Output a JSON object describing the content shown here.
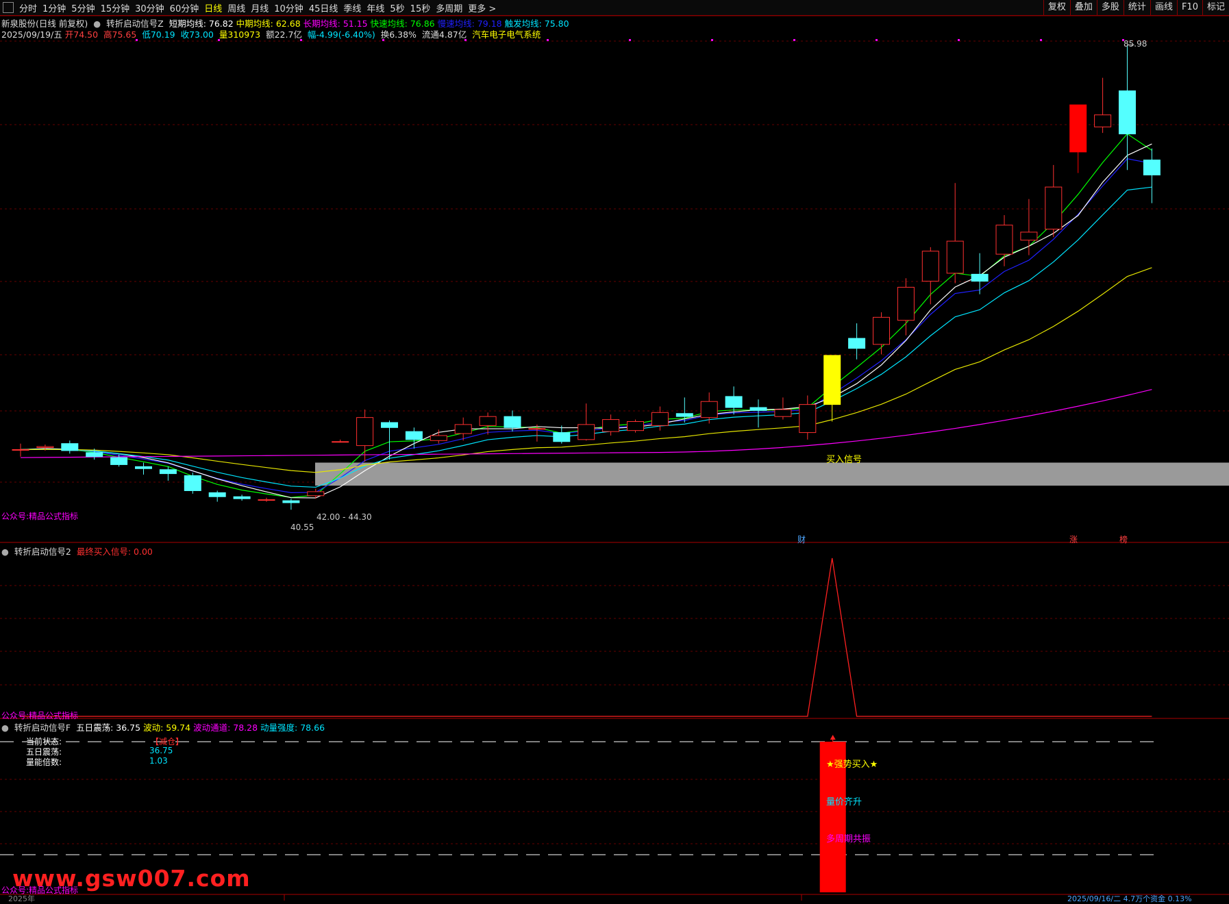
{
  "toolbar": {
    "periods": [
      "分时",
      "1分钟",
      "5分钟",
      "15分钟",
      "30分钟",
      "60分钟",
      "日线",
      "周线",
      "月线",
      "10分钟",
      "45日线",
      "季线",
      "年线",
      "5秒",
      "15秒",
      "多周期",
      "更多 >"
    ],
    "active_period": "日线",
    "right_buttons": [
      "复权",
      "叠加",
      "多股",
      "统计",
      "画线",
      "F10",
      "标记"
    ]
  },
  "header": {
    "stock_title": "新泉股份(日线 前复权)",
    "indicator_name": "转折启动信号Z",
    "ma": [
      {
        "label": "短期均线:",
        "value": "76.82",
        "color": "#ffffff"
      },
      {
        "label": "中期均线:",
        "value": "62.68",
        "color": "#ffff00"
      },
      {
        "label": "长期均线:",
        "value": "51.15",
        "color": "#ff00ff"
      },
      {
        "label": "快速均线:",
        "value": "76.86",
        "color": "#00ff00"
      },
      {
        "label": "慢速均线:",
        "value": "79.18",
        "color": "#2020ff"
      },
      {
        "label": "触发均线:",
        "value": "75.80",
        "color": "#00e5ff"
      }
    ]
  },
  "quote": {
    "date": "2025/09/19/五",
    "open": "开74.50",
    "high": "高75.65",
    "low": "低70.19",
    "close": "收73.00",
    "volume": "量310973",
    "amount": "额22.7亿",
    "change": "幅-4.99(-6.40%)",
    "turnover": "换6.38%",
    "float": "流通4.87亿",
    "sector": "汽车电子电气系统"
  },
  "main_chart": {
    "price_high_label": "85.98",
    "price_low_label": "40.55",
    "range_label": "42.00 - 44.30",
    "buy_signal_label": "买入信号",
    "footer_label": "公众号:精品公式指标",
    "markers": [
      {
        "text": "财",
        "color": "#4da6ff"
      },
      {
        "text": "涨",
        "color": "#ff4040"
      },
      {
        "text": "榜",
        "color": "#ff4040"
      }
    ],
    "candles": [
      {
        "o": 45.6,
        "c": 45.6,
        "h": 46.2,
        "l": 44.9,
        "dir": "up"
      },
      {
        "o": 45.9,
        "c": 45.8,
        "h": 46.1,
        "l": 45.5,
        "dir": "up"
      },
      {
        "o": 46.2,
        "c": 45.5,
        "h": 46.5,
        "l": 45.2,
        "dir": "down"
      },
      {
        "o": 45.3,
        "c": 44.9,
        "h": 45.7,
        "l": 44.6,
        "dir": "down"
      },
      {
        "o": 44.8,
        "c": 44.1,
        "h": 45.1,
        "l": 43.9,
        "dir": "down"
      },
      {
        "o": 43.9,
        "c": 43.7,
        "h": 44.3,
        "l": 43.1,
        "dir": "down"
      },
      {
        "o": 43.6,
        "c": 43.2,
        "h": 43.9,
        "l": 42.5,
        "dir": "down"
      },
      {
        "o": 43.0,
        "c": 41.5,
        "h": 43.3,
        "l": 41.2,
        "dir": "down"
      },
      {
        "o": 41.3,
        "c": 40.9,
        "h": 41.5,
        "l": 40.4,
        "dir": "down"
      },
      {
        "o": 40.9,
        "c": 40.7,
        "h": 41.1,
        "l": 40.5,
        "dir": "down"
      },
      {
        "o": 40.6,
        "c": 40.6,
        "h": 40.8,
        "l": 40.4,
        "dir": "up"
      },
      {
        "o": 40.5,
        "c": 40.3,
        "h": 40.7,
        "l": 39.6,
        "dir": "down"
      },
      {
        "o": 41.0,
        "c": 41.4,
        "h": 41.7,
        "l": 40.7,
        "dir": "up"
      },
      {
        "o": 46.4,
        "c": 46.4,
        "h": 46.6,
        "l": 46.3,
        "dir": "up"
      },
      {
        "o": 46.0,
        "c": 48.8,
        "h": 49.6,
        "l": 44.4,
        "dir": "up"
      },
      {
        "o": 48.3,
        "c": 47.8,
        "h": 48.5,
        "l": 44.6,
        "dir": "down"
      },
      {
        "o": 47.4,
        "c": 46.6,
        "h": 47.8,
        "l": 45.7,
        "dir": "down"
      },
      {
        "o": 46.5,
        "c": 47.0,
        "h": 47.6,
        "l": 46.2,
        "dir": "up"
      },
      {
        "o": 47.2,
        "c": 48.1,
        "h": 48.8,
        "l": 46.5,
        "dir": "up"
      },
      {
        "o": 48.0,
        "c": 48.9,
        "h": 49.3,
        "l": 47.1,
        "dir": "up"
      },
      {
        "o": 48.9,
        "c": 47.8,
        "h": 49.5,
        "l": 47.4,
        "dir": "down"
      },
      {
        "o": 47.7,
        "c": 47.7,
        "h": 48.1,
        "l": 46.4,
        "dir": "up"
      },
      {
        "o": 47.3,
        "c": 46.4,
        "h": 48.0,
        "l": 46.2,
        "dir": "down"
      },
      {
        "o": 46.6,
        "c": 48.1,
        "h": 50.2,
        "l": 46.5,
        "dir": "up"
      },
      {
        "o": 47.4,
        "c": 48.6,
        "h": 49.1,
        "l": 47.0,
        "dir": "up"
      },
      {
        "o": 47.5,
        "c": 48.4,
        "h": 48.6,
        "l": 47.3,
        "dir": "up"
      },
      {
        "o": 48.0,
        "c": 49.3,
        "h": 49.9,
        "l": 47.5,
        "dir": "up"
      },
      {
        "o": 49.2,
        "c": 48.9,
        "h": 50.8,
        "l": 48.3,
        "dir": "down"
      },
      {
        "o": 48.8,
        "c": 50.4,
        "h": 51.3,
        "l": 48.2,
        "dir": "up"
      },
      {
        "o": 50.9,
        "c": 49.8,
        "h": 51.9,
        "l": 49.1,
        "dir": "down"
      },
      {
        "o": 49.8,
        "c": 49.5,
        "h": 50.6,
        "l": 47.8,
        "dir": "down"
      },
      {
        "o": 48.9,
        "c": 49.6,
        "h": 50.8,
        "l": 48.6,
        "dir": "up"
      },
      {
        "o": 47.3,
        "c": 50.1,
        "h": 51.0,
        "l": 46.6,
        "dir": "up"
      },
      {
        "o": 50.1,
        "c": 55.0,
        "h": 55.0,
        "l": 48.4,
        "dir": "yellow"
      },
      {
        "o": 55.7,
        "c": 56.7,
        "h": 58.2,
        "l": 54.6,
        "dir": "down"
      },
      {
        "o": 56.1,
        "c": 58.8,
        "h": 59.3,
        "l": 55.1,
        "dir": "up"
      },
      {
        "o": 58.5,
        "c": 61.8,
        "h": 62.7,
        "l": 57.0,
        "dir": "up"
      },
      {
        "o": 62.4,
        "c": 65.4,
        "h": 65.8,
        "l": 60.1,
        "dir": "up"
      },
      {
        "o": 63.2,
        "c": 66.4,
        "h": 72.2,
        "l": 62.2,
        "dir": "up"
      },
      {
        "o": 63.1,
        "c": 62.4,
        "h": 65.2,
        "l": 61.1,
        "dir": "down"
      },
      {
        "o": 65.1,
        "c": 68.0,
        "h": 69.0,
        "l": 63.9,
        "dir": "up"
      },
      {
        "o": 66.5,
        "c": 67.3,
        "h": 70.6,
        "l": 65.0,
        "dir": "up"
      },
      {
        "o": 67.6,
        "c": 71.8,
        "h": 74.0,
        "l": 66.8,
        "dir": "up"
      },
      {
        "o": 80.0,
        "c": 75.3,
        "h": 80.0,
        "l": 73.2,
        "dir": "red"
      },
      {
        "o": 77.8,
        "c": 79.0,
        "h": 82.7,
        "l": 77.2,
        "dir": "up"
      },
      {
        "o": 77.1,
        "c": 81.4,
        "h": 85.98,
        "l": 73.5,
        "dir": "down"
      },
      {
        "o": 74.5,
        "c": 73.0,
        "h": 75.65,
        "l": 70.19,
        "dir": "down"
      }
    ]
  },
  "sub1": {
    "indicator_name": "转折启动信号2",
    "param": "最终买入信号: 0.00",
    "footer_label": "公众号:精品公式指标",
    "values": [
      0,
      0,
      0,
      0,
      0,
      0,
      0,
      0,
      0,
      0,
      0,
      0,
      0,
      0,
      0,
      0,
      0,
      0,
      0,
      0,
      0,
      0,
      0,
      0,
      0,
      0,
      0,
      0,
      0,
      0,
      0,
      0,
      0,
      1,
      0,
      0,
      0,
      0,
      0,
      0,
      0,
      0,
      0,
      0,
      0,
      0,
      0
    ]
  },
  "sub2": {
    "indicator_name": "转折启动信号F",
    "params": [
      {
        "label": "五日震荡:",
        "value": "36.75",
        "color": "#ffffff"
      },
      {
        "label": "波动:",
        "value": "59.74",
        "color": "#ffff00"
      },
      {
        "label": "波动通道:",
        "value": "78.28",
        "color": "#ff00ff"
      },
      {
        "label": "动量强度:",
        "value": "78.66",
        "color": "#00e5ff"
      }
    ],
    "status_rows": [
      {
        "label": "当前状态:",
        "value": "【减仓】",
        "color": "#ff3030"
      },
      {
        "label": "五日震荡:",
        "value": "36.75",
        "color": "#00e5ff"
      },
      {
        "label": "量能倍数:",
        "value": "1.03",
        "color": "#00e5ff"
      }
    ],
    "signal_labels": [
      {
        "text": "★强势买入★",
        "color": "#ffff00"
      },
      {
        "text": "量价齐升",
        "color": "#00e5ff"
      },
      {
        "text": "多周期共振",
        "color": "#ff00ff"
      }
    ],
    "footer_label": "公众号:精品公式指标",
    "bottom_date": "2025年",
    "bottom_right": "2025/09/16/二 4.7万个资金 0.13%"
  },
  "watermark": "www.gsw007.com"
}
